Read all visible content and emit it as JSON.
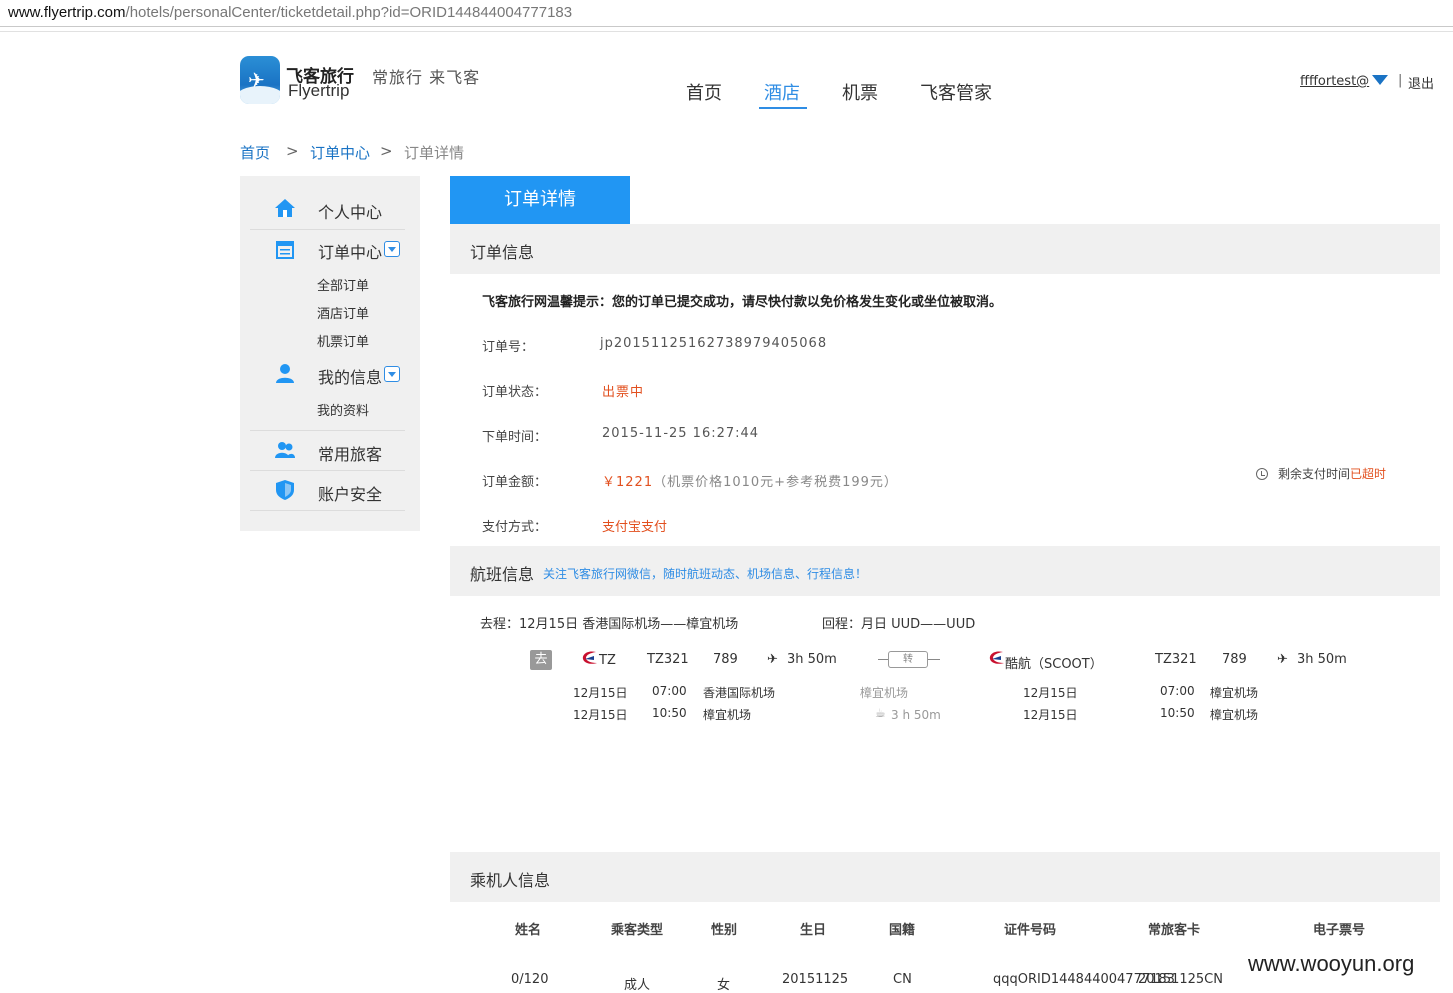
{
  "browser": {
    "url_host": "www.flyertrip.com",
    "url_path": "/hotels/personalCenter/ticketdetail.php?id=ORID144844004777183"
  },
  "brand": {
    "name_cn": "飞客旅行",
    "name_en": "Flyertrip",
    "slogan": "常旅行 来飞客"
  },
  "nav": {
    "items": [
      "首页",
      "酒店",
      "机票",
      "飞客管家"
    ],
    "active_index": 1
  },
  "user": {
    "name": "ffffortest@",
    "logout": "退出",
    "sep": "|"
  },
  "breadcrumb": {
    "home": "首页",
    "center": "订单中心",
    "current": "订单详情",
    "sep": ">"
  },
  "sidebar": {
    "personal": "个人中心",
    "orders": "订单中心",
    "orders_sub": [
      "全部订单",
      "酒店订单",
      "机票订单"
    ],
    "myinfo": "我的信息",
    "myinfo_sub": [
      "我的资料"
    ],
    "travelers": "常用旅客",
    "security": "账户安全"
  },
  "main": {
    "tab": "订单详情",
    "order_section": "订单信息",
    "notice": "飞客旅行网温馨提示：您的订单已提交成功，请尽快付款以免价格发生变化或坐位被取消。",
    "fields": {
      "order_no_label": "订单号：",
      "order_no": "jp20151125162738979405068",
      "status_label": "订单状态：",
      "status": "出票中",
      "time_label": "下单时间：",
      "time": "2015-11-25 16:27:44",
      "amount_label": "订单金额：",
      "amount": "￥1221",
      "amount_detail": "（机票价格1010元+参考税费199元）",
      "pay_label": "支付方式：",
      "pay": "支付宝支付"
    },
    "pay_timer": {
      "text": "剩余支付时间",
      "state": "已超时"
    },
    "flight_section": "航班信息",
    "flight_note": "关注飞客旅行网微信，随时航班动态、机场信息、行程信息！",
    "route_out": "去程：12月15日 香港国际机场——樟宜机场",
    "route_back": "回程：月日 UUD——UUD",
    "leg_badge": "去",
    "leg1": {
      "airline": "TZ",
      "flight": "TZ321",
      "plane": "789",
      "duration": "3h 50m",
      "dep_date": "12月15日",
      "dep_time": "07:00",
      "dep_airport": "香港国际机场",
      "arr_date": "12月15日",
      "arr_time": "10:50",
      "arr_airport": "樟宜机场"
    },
    "transfer": {
      "label": "转",
      "airport": "樟宜机场",
      "wait": "3 h 50m"
    },
    "leg2": {
      "airline": "酷航（SCOOT）",
      "flight": "TZ321",
      "plane": "789",
      "duration": "3h 50m",
      "dep_date": "12月15日",
      "dep_time": "07:00",
      "dep_airport": "樟宜机场",
      "arr_date": "12月15日",
      "arr_time": "10:50",
      "arr_airport": "樟宜机场"
    },
    "passenger_section": "乘机人信息",
    "passenger_headers": [
      "姓名",
      "乘客类型",
      "性别",
      "生日",
      "国籍",
      "证件号码",
      "常旅客卡",
      "电子票号"
    ],
    "passenger_row": [
      "0/120",
      "成人",
      "女",
      "20151125",
      "CN",
      "qqqORID144844004777183",
      "20151125CN",
      ""
    ]
  },
  "watermark": "www.wooyun.org",
  "colors": {
    "accent": "#2196f3",
    "link": "#1a73c4",
    "alert": "#e2501f"
  }
}
